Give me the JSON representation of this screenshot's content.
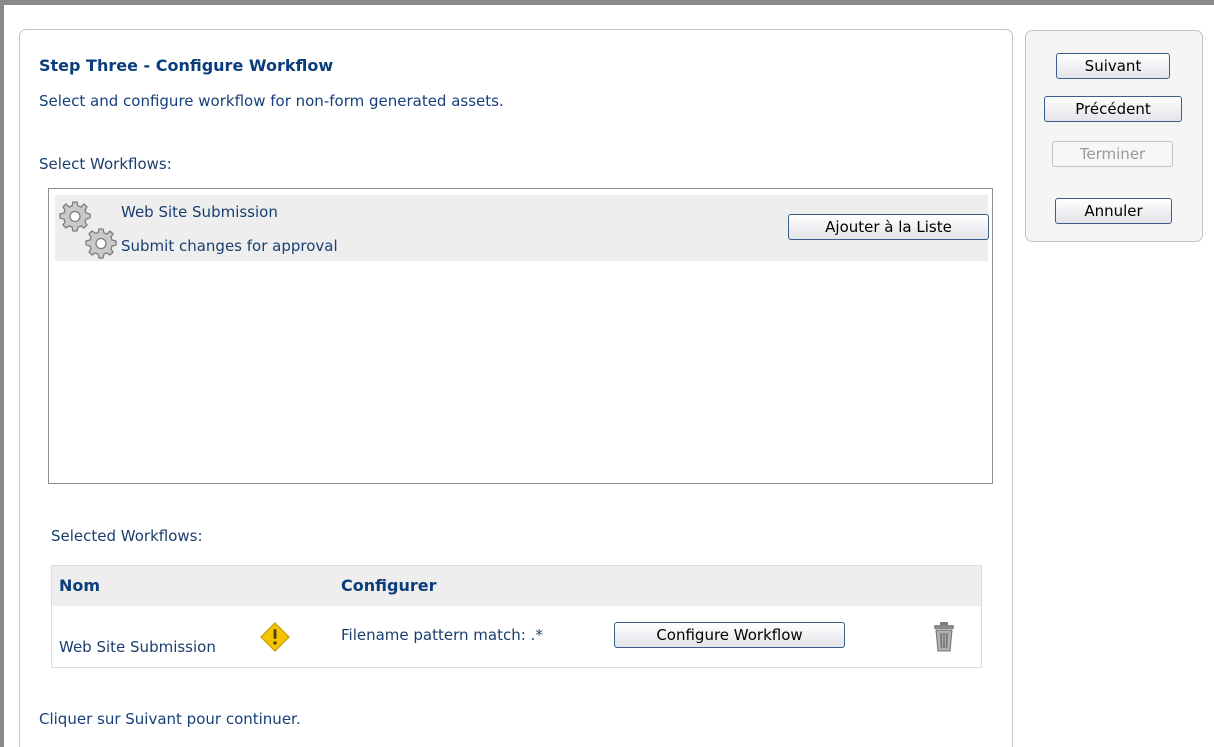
{
  "step": {
    "title": "Step Three - Configure Workflow",
    "subtitle": "Select and configure workflow for non-form generated assets."
  },
  "select_workflows": {
    "label": "Select Workflows:",
    "items": [
      {
        "name": "Web Site Submission",
        "description": "Submit changes for approval",
        "icon": "gears-icon",
        "add_button": "Ajouter à la Liste"
      }
    ]
  },
  "selected_workflows": {
    "label": "Selected Workflows:",
    "columns": [
      "Nom",
      "Configurer"
    ],
    "rows": [
      {
        "name": "Web Site Submission",
        "warning_icon": "warning-icon",
        "config_text": "Filename pattern match: .*",
        "config_button": "Configure Workflow",
        "delete_icon": "trash-icon"
      }
    ]
  },
  "footer": {
    "text": "Cliquer sur Suivant pour continuer."
  },
  "nav": {
    "next": "Suivant",
    "previous": "Précédent",
    "finish": "Terminer",
    "cancel": "Annuler"
  },
  "colors": {
    "title": "#0a3d7a",
    "text": "#1a3e6e",
    "row_background": "#eeeeee",
    "warning": "#f5c400"
  }
}
